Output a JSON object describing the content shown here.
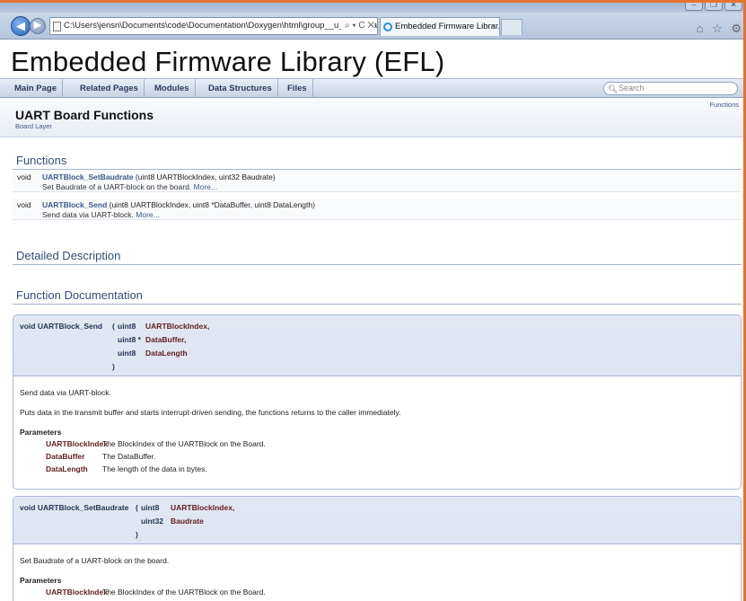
{
  "browser": {
    "url": "C:\\Users\\jensn\\Documents\\code\\Documentation\\Doxygen\\html\\group__u_a_r_tboard.l",
    "url_controls": "⌕ ▾ C ✕",
    "tab_title": "Embedded Firmware Librar...",
    "tab_close": "×",
    "window_buttons": [
      "–",
      "❐",
      "✕"
    ],
    "right_icons": "⌂ ☆ ⚙"
  },
  "project": {
    "title": "Embedded Firmware Library (EFL)"
  },
  "nav": {
    "tabs": [
      "Main Page",
      "Related Pages",
      "Modules",
      "Data Structures",
      "Files"
    ],
    "search_placeholder": "Search"
  },
  "header": {
    "summary_link": "Functions",
    "title": "UART Board Functions",
    "ingroup": "Board Layer"
  },
  "sections": {
    "functions": "Functions",
    "detailed": "Detailed Description",
    "function_doc": "Function Documentation"
  },
  "members": [
    {
      "type": "void",
      "name": "UARTBlock_SetBaudrate",
      "args": " (uint8 UARTBlockIndex, uint32 Baudrate)",
      "brief": "Set Baudrate of a UART-block on the board.",
      "more": "More..."
    },
    {
      "type": "void",
      "name": "UARTBlock_Send",
      "args": " (uint8 UARTBlockIndex, uint8 *DataBuffer, uint8 DataLength)",
      "brief": "Send data via UART-block.",
      "more": "More..."
    }
  ],
  "docs": {
    "send": {
      "proto_name": "void UARTBlock_Send",
      "open": "(",
      "params": [
        {
          "type": "uint8",
          "name": "UARTBlockIndex,"
        },
        {
          "type": "uint8 *",
          "name": "DataBuffer,"
        },
        {
          "type": "uint8",
          "name": "DataLength"
        }
      ],
      "close": ")",
      "brief": "Send data via UART-block.",
      "details": "Puts data in the transmit buffer and starts interrupt-driven sending, the functions returns to the caller immediately.",
      "params_title": "Parameters",
      "param_docs": [
        {
          "name": "UARTBlockIndex",
          "desc": "The BlockIndex of the UARTBlock on the Board."
        },
        {
          "name": "DataBuffer",
          "desc": "The DataBuffer."
        },
        {
          "name": "DataLength",
          "desc": "The length of the data in bytes."
        }
      ]
    },
    "setbaud": {
      "proto_name": "void UARTBlock_SetBaudrate",
      "open": "(",
      "params": [
        {
          "type": "uint8",
          "name": "UARTBlockIndex,"
        },
        {
          "type": "uint32",
          "name": "Baudrate"
        }
      ],
      "close": ")",
      "brief": "Set Baudrate of a UART-block on the board.",
      "params_title": "Parameters",
      "param_docs": [
        {
          "name": "UARTBlockIndex",
          "desc": "The BlockIndex of the UARTBlock on the Board."
        }
      ]
    }
  },
  "colors": {
    "link": "#3d578c",
    "param": "#602020",
    "accent_frame": "#e8722c"
  }
}
